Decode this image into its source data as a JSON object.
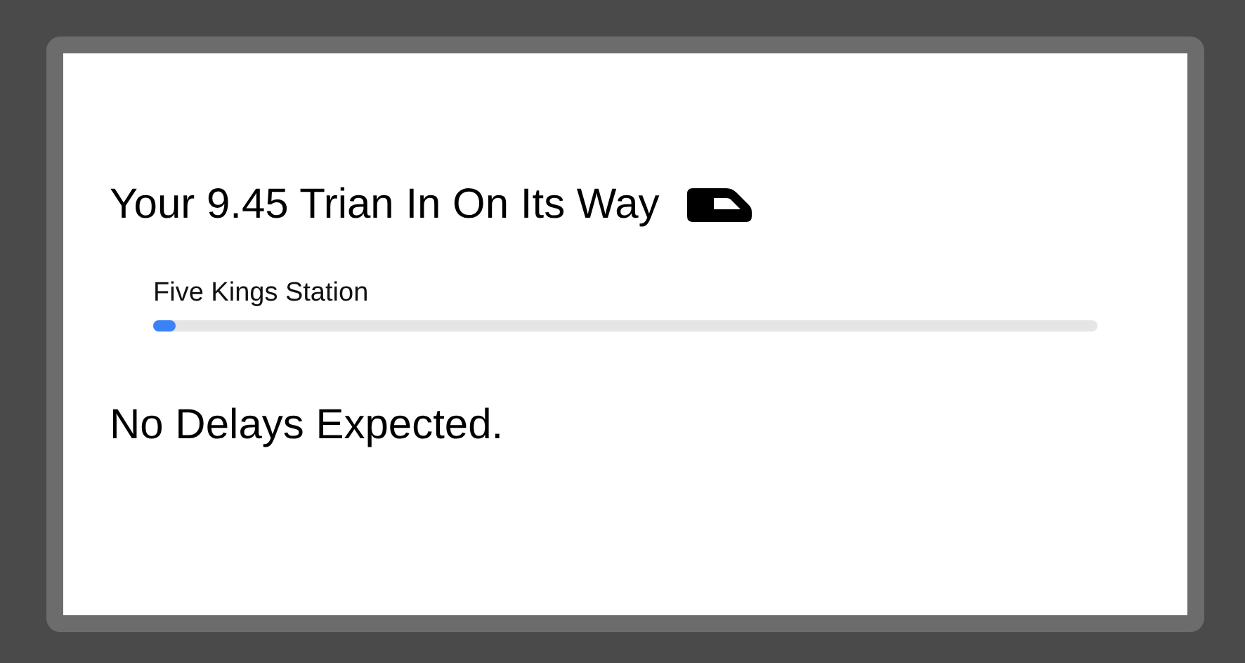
{
  "title": "Your 9.45 Trian In On Its Way",
  "progress": {
    "label": "Five Kings Station",
    "level": 0.024
  },
  "status": "No Delays Expected."
}
